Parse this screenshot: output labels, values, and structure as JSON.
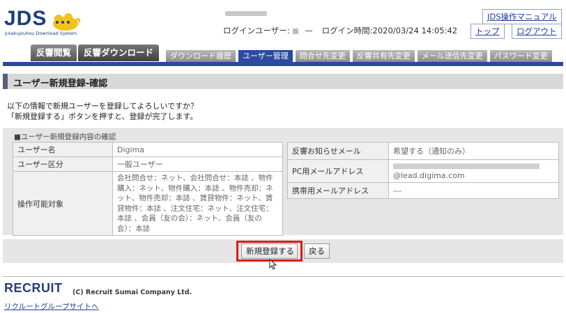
{
  "header": {
    "logo_text": "JDS",
    "logo_sub": "Jutakujouhou Download System",
    "login_user_label": "ログインユーザー:",
    "login_time_label": "ログイン時間:",
    "login_time": "2020/03/24 14:05:42",
    "manual_link": "JDS操作マニュアル",
    "top_link": "トップ",
    "logout_link": "ログアウト"
  },
  "main_tabs": [
    "反響閲覧",
    "反響ダウンロード"
  ],
  "sub_tabs": [
    {
      "label": "ダウンロード履歴",
      "active": false
    },
    {
      "label": "ユーザー管理",
      "active": true
    },
    {
      "label": "問合せ先変更",
      "active": false
    },
    {
      "label": "反響共有先変更",
      "active": false
    },
    {
      "label": "メール送信先変更",
      "active": false
    },
    {
      "label": "パスワード変更",
      "active": false
    }
  ],
  "page_title": "ユーザー新規登録-確認",
  "intro": {
    "line1": "以下の情報で新規ユーザーを登録してよろしいですか？",
    "line2": "「新規登録する」ボタンを押すと、登録が完了します。"
  },
  "confirm": {
    "section_title": "■ユーザー新規登録内容の確認",
    "left": {
      "username_label": "ユーザー名",
      "username_value": "Digima",
      "type_label": "ユーザー区分",
      "type_value": "一般ユーザー",
      "ops_label": "操作可能対象",
      "ops_value": "会社問合せ：ネット、会社問合せ：本誌 、物件購入：ネット、物件購入：本誌 、物件売却：ネット、物件売却：本誌 、賃貸物件：ネット、賃貸物件：本誌 、注文住宅：ネット、注文住宅：本誌 、会員（友の会）：ネット、会員（友の会）：本誌"
    },
    "right": {
      "notice_label": "反響お知らせメール",
      "notice_value": "希望する（通知のみ）",
      "pc_mail_label": "PC用メールアドレス",
      "pc_mail_domain": "@lead.digima.com",
      "mobile_mail_label": "携帯用メールアドレス",
      "mobile_mail_value": "---"
    }
  },
  "actions": {
    "register_label": "新規登録する",
    "back_label": "戻る"
  },
  "footer": {
    "logo": "RECRUIT",
    "copyright": "(C) Recruit Sumai Company Ltd.",
    "group_link": "リクルートグループサイトへ"
  },
  "colors": {
    "accent": "#2b4aa0",
    "highlight": "#e01818"
  }
}
